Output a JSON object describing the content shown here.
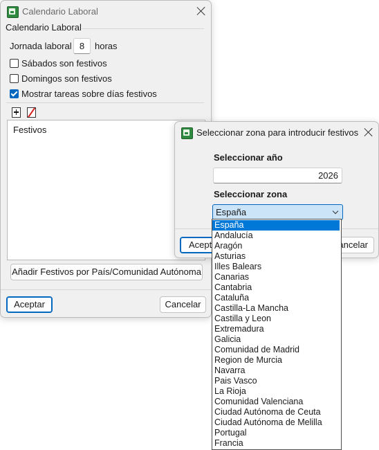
{
  "main_dialog": {
    "title": "Calendario Laboral",
    "group_label": "Calendario Laboral",
    "jornada_label": "Jornada laboral",
    "jornada_value": "8",
    "horas_label": "horas",
    "checkboxes": [
      {
        "label": "Sábados son festivos",
        "checked": false
      },
      {
        "label": "Domingos son festivos",
        "checked": false
      },
      {
        "label": "Mostrar tareas sobre días festivos",
        "checked": true
      }
    ],
    "list_header": "Festivos",
    "add_holidays_button": "Añadir Festivos por País/Comunidad Autónoma",
    "accept_button": "Aceptar",
    "cancel_button": "Cancelar"
  },
  "zone_dialog": {
    "title": "Seleccionar zona para introducir festivos",
    "year_label": "Seleccionar año",
    "year_value": "2026",
    "zone_label": "Seleccionar zona",
    "zone_selected": "España",
    "accept_button_partial": "Acepta",
    "cancel_button_partial": "ancelar",
    "dropdown_options": [
      "España",
      "Andalucía",
      "Aragón",
      "Asturias",
      "Illes Balears",
      "Canarias",
      "Cantabria",
      "Cataluña",
      "Castilla-La Mancha",
      "Castilla y Leon",
      "Extremadura",
      "Galicia",
      "Comunidad de Madrid",
      "Region de Murcia",
      "Navarra",
      "Pais Vasco",
      "La Rioja",
      "Comunidad Valenciana",
      "Ciudad Autónoma de Ceuta",
      "Ciudad Autónoma de Melilla",
      "Portugal",
      "Francia"
    ]
  },
  "colors": {
    "accent": "#0067c0",
    "selection": "#0078d7",
    "window_bg": "#f0f0f0"
  },
  "icons": [
    "app-calendar-icon",
    "close-icon",
    "add-icon",
    "delete-icon",
    "chevron-down-icon",
    "checkmark-icon"
  ]
}
